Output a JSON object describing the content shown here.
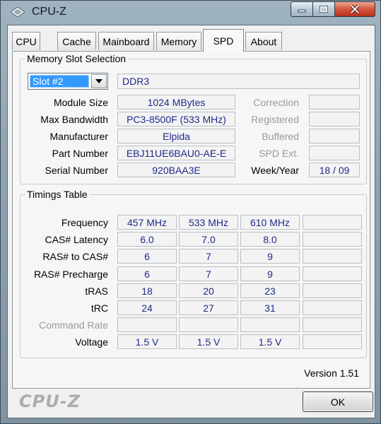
{
  "window": {
    "title": "CPU-Z"
  },
  "tabs": [
    "CPU",
    "Cache",
    "Mainboard",
    "Memory",
    "SPD",
    "About"
  ],
  "active_tab": "SPD",
  "slot_group": {
    "legend": "Memory Slot Selection",
    "slot": "Slot #2",
    "type": "DDR3",
    "fields": {
      "module_size": {
        "label": "Module Size",
        "value": "1024 MBytes"
      },
      "max_bandwidth": {
        "label": "Max Bandwidth",
        "value": "PC3-8500F (533 MHz)"
      },
      "manufacturer": {
        "label": "Manufacturer",
        "value": "Elpida"
      },
      "part_number": {
        "label": "Part Number",
        "value": "EBJ11UE6BAU0-AE-E"
      },
      "serial_number": {
        "label": "Serial Number",
        "value": "920BAA3E"
      }
    },
    "right_fields": {
      "correction": "Correction",
      "registered": "Registered",
      "buffered": "Buffered",
      "spd_ext": "SPD Ext.",
      "week_year_label": "Week/Year",
      "week_year_value": "18 / 09"
    }
  },
  "timings": {
    "legend": "Timings Table",
    "rows": [
      {
        "label": "Frequency",
        "values": [
          "457 MHz",
          "533 MHz",
          "610 MHz",
          ""
        ],
        "dim": false
      },
      {
        "label": "CAS# Latency",
        "values": [
          "6.0",
          "7.0",
          "8.0",
          ""
        ],
        "dim": false
      },
      {
        "label": "RAS# to CAS#",
        "values": [
          "6",
          "7",
          "9",
          ""
        ],
        "dim": false
      },
      {
        "label": "RAS# Precharge",
        "values": [
          "6",
          "7",
          "9",
          ""
        ],
        "dim": false
      },
      {
        "label": "tRAS",
        "values": [
          "18",
          "20",
          "23",
          ""
        ],
        "dim": false
      },
      {
        "label": "tRC",
        "values": [
          "24",
          "27",
          "31",
          ""
        ],
        "dim": false
      },
      {
        "label": "Command Rate",
        "values": [
          "",
          "",
          "",
          ""
        ],
        "dim": true
      },
      {
        "label": "Voltage",
        "values": [
          "1.5 V",
          "1.5 V",
          "1.5 V",
          ""
        ],
        "dim": false
      }
    ]
  },
  "version": "Version 1.51",
  "logo": "CPU-Z",
  "ok_label": "OK"
}
